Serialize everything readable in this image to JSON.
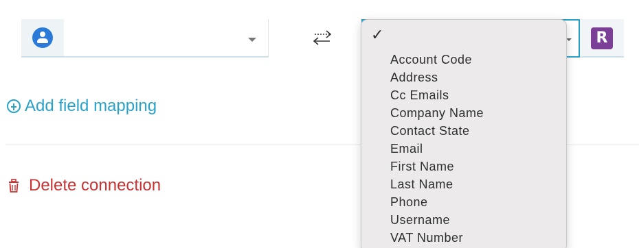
{
  "mapping": {
    "left_select": {
      "value": "",
      "icon": "user-icon"
    },
    "swap_icon": "swap-arrows-icon",
    "right_select": {
      "logo_letter": "R",
      "logo_color": "#7b3f98"
    }
  },
  "actions": {
    "add_field_mapping": "Add field mapping",
    "delete_connection": "Delete connection"
  },
  "dropdown": {
    "selected": "",
    "options": [
      "Account Code",
      "Address",
      "Cc Emails",
      "Company Name",
      "Contact State",
      "Email",
      "First Name",
      "Last Name",
      "Phone",
      "Username",
      "VAT Number"
    ]
  },
  "colors": {
    "accent": "#2aa2c8",
    "danger": "#c93232",
    "user_icon": "#2a7ad9"
  }
}
